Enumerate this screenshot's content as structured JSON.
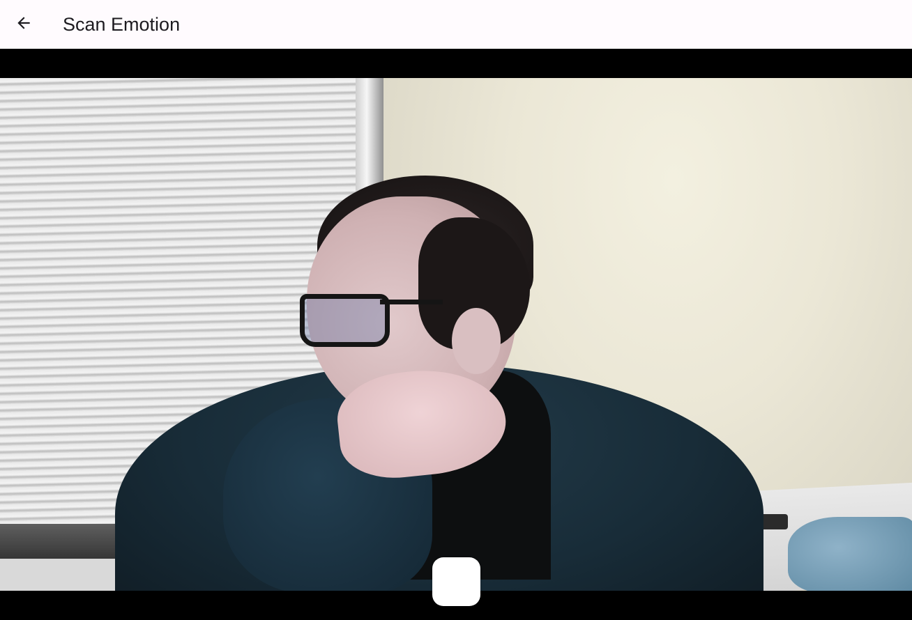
{
  "app_bar": {
    "title": "Scan Emotion",
    "back_icon": "arrow-left-icon"
  },
  "camera": {
    "capture_button_icon": "capture-shutter"
  },
  "colors": {
    "app_bar_background": "#fffbfe",
    "title_text": "#1d1b20",
    "camera_background": "#000000",
    "capture_button": "#ffffff"
  }
}
